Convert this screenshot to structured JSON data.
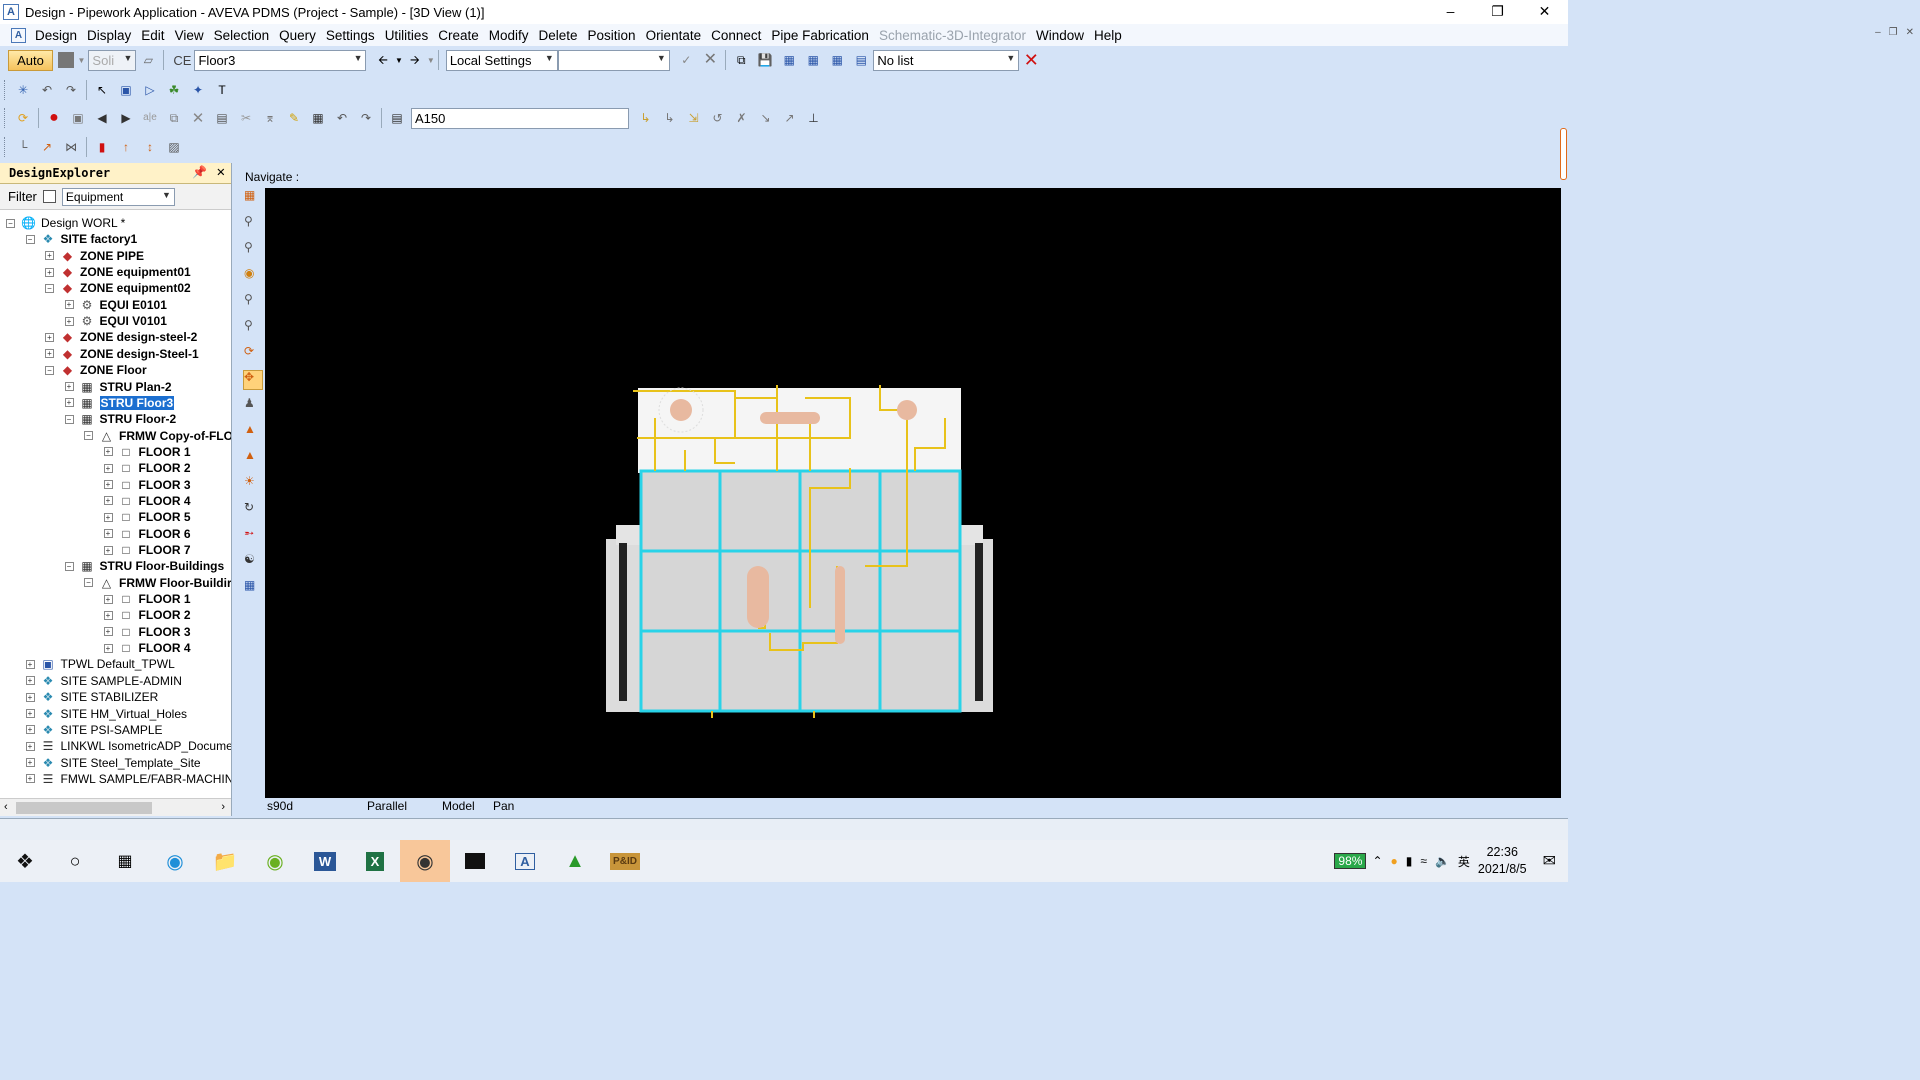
{
  "window": {
    "title": "Design - Pipework Application - AVEVA PDMS (Project - Sample) - [3D View (1)]",
    "icon": "A"
  },
  "menu": [
    "Design",
    "Display",
    "Edit",
    "View",
    "Selection",
    "Query",
    "Settings",
    "Utilities",
    "Create",
    "Modify",
    "Delete",
    "Position",
    "Orientate",
    "Connect",
    "Pipe Fabrication",
    "Schematic-3D-Integrator",
    "Window",
    "Help"
  ],
  "toolbar1": {
    "auto_label": "Auto",
    "soli_label": "Soli",
    "ce_label": "CE",
    "ce_value": "Floor3",
    "settings_value": "Local Settings",
    "list_value": "No list"
  },
  "toolbar3": {
    "spec_value": "A150"
  },
  "explorer": {
    "title": "DesignExplorer",
    "filter_label": "Filter",
    "filter_value": "Equipment",
    "tree": [
      {
        "text": "Design WORL *",
        "ico": "globe",
        "exp": "-",
        "lvl": 0,
        "b": false
      },
      {
        "text": "SITE factory1",
        "ico": "site",
        "exp": "-",
        "lvl": 1,
        "b": true
      },
      {
        "text": "ZONE PIPE",
        "ico": "zone",
        "exp": "+",
        "lvl": 2,
        "b": true
      },
      {
        "text": "ZONE equipment01",
        "ico": "zone",
        "exp": "+",
        "lvl": 2,
        "b": true
      },
      {
        "text": "ZONE equipment02",
        "ico": "zone",
        "exp": "-",
        "lvl": 2,
        "b": true
      },
      {
        "text": "EQUI E0101",
        "ico": "equi",
        "exp": "+",
        "lvl": 3,
        "b": true
      },
      {
        "text": "EQUI V0101",
        "ico": "equi",
        "exp": "+",
        "lvl": 3,
        "b": true
      },
      {
        "text": "ZONE design-steel-2",
        "ico": "zone",
        "exp": "+",
        "lvl": 2,
        "b": true
      },
      {
        "text": "ZONE design-Steel-1",
        "ico": "zone",
        "exp": "+",
        "lvl": 2,
        "b": true
      },
      {
        "text": "ZONE Floor",
        "ico": "zone",
        "exp": "-",
        "lvl": 2,
        "b": true
      },
      {
        "text": "STRU Plan-2",
        "ico": "stru",
        "exp": "+",
        "lvl": 3,
        "b": true
      },
      {
        "text": "STRU Floor3",
        "ico": "stru",
        "exp": "+",
        "lvl": 3,
        "b": true,
        "sel": true
      },
      {
        "text": "STRU Floor-2",
        "ico": "stru",
        "exp": "-",
        "lvl": 3,
        "b": true
      },
      {
        "text": "FRMW Copy-of-FLO",
        "ico": "frmw",
        "exp": "-",
        "lvl": 4,
        "b": true
      },
      {
        "text": "FLOOR 1",
        "ico": "floor",
        "exp": "+",
        "lvl": 5,
        "b": true
      },
      {
        "text": "FLOOR 2",
        "ico": "floor",
        "exp": "+",
        "lvl": 5,
        "b": true
      },
      {
        "text": "FLOOR 3",
        "ico": "floor",
        "exp": "+",
        "lvl": 5,
        "b": true
      },
      {
        "text": "FLOOR 4",
        "ico": "floor",
        "exp": "+",
        "lvl": 5,
        "b": true
      },
      {
        "text": "FLOOR 5",
        "ico": "floor",
        "exp": "+",
        "lvl": 5,
        "b": true
      },
      {
        "text": "FLOOR 6",
        "ico": "floor",
        "exp": "+",
        "lvl": 5,
        "b": true
      },
      {
        "text": "FLOOR 7",
        "ico": "floor",
        "exp": "+",
        "lvl": 5,
        "b": true
      },
      {
        "text": "STRU Floor-Buildings",
        "ico": "stru",
        "exp": "-",
        "lvl": 3,
        "b": true
      },
      {
        "text": "FRMW Floor-Buildir",
        "ico": "frmw",
        "exp": "-",
        "lvl": 4,
        "b": true
      },
      {
        "text": "FLOOR 1",
        "ico": "floor",
        "exp": "+",
        "lvl": 5,
        "b": true
      },
      {
        "text": "FLOOR 2",
        "ico": "floor",
        "exp": "+",
        "lvl": 5,
        "b": true
      },
      {
        "text": "FLOOR 3",
        "ico": "floor",
        "exp": "+",
        "lvl": 5,
        "b": true
      },
      {
        "text": "FLOOR 4",
        "ico": "floor",
        "exp": "+",
        "lvl": 5,
        "b": true
      },
      {
        "text": "TPWL Default_TPWL",
        "ico": "tpwl",
        "exp": "+",
        "lvl": 1,
        "b": false
      },
      {
        "text": "SITE SAMPLE-ADMIN",
        "ico": "site",
        "exp": "+",
        "lvl": 1,
        "b": false
      },
      {
        "text": "SITE STABILIZER",
        "ico": "site",
        "exp": "+",
        "lvl": 1,
        "b": false
      },
      {
        "text": "SITE HM_Virtual_Holes",
        "ico": "site",
        "exp": "+",
        "lvl": 1,
        "b": false
      },
      {
        "text": "SITE PSI-SAMPLE",
        "ico": "site",
        "exp": "+",
        "lvl": 1,
        "b": false
      },
      {
        "text": "LINKWL IsometricADP_Docume",
        "ico": "link",
        "exp": "+",
        "lvl": 1,
        "b": false
      },
      {
        "text": "SITE Steel_Template_Site",
        "ico": "site",
        "exp": "+",
        "lvl": 1,
        "b": false
      },
      {
        "text": "FMWL SAMPLE/FABR-MACHINE",
        "ico": "link",
        "exp": "+",
        "lvl": 1,
        "b": false
      }
    ]
  },
  "view": {
    "navigate_label": "Navigate :",
    "status": {
      "direction": "s90d",
      "projection": "Parallel",
      "mode": "Model",
      "action": "Pan"
    }
  },
  "taskbar": {
    "battery": "98%",
    "ime": "英",
    "time": "22:36",
    "date": "2021/8/5"
  },
  "colors": {
    "selection": "#1c6fd0",
    "grid": "#29d3e8",
    "pipe": "#e8c21a",
    "vessel": "#e8b9a0"
  }
}
